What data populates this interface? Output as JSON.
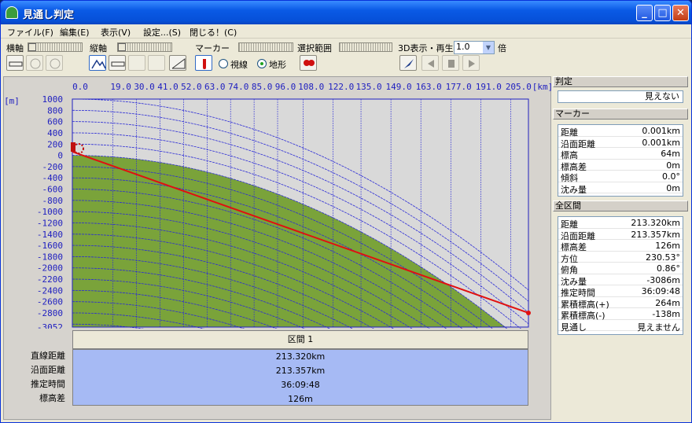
{
  "window": {
    "title": "見通し判定",
    "minimize": "_",
    "maximize": "□",
    "close": "✕"
  },
  "menu": [
    "ファイル(F)",
    "編集(E)",
    "表示(V)",
    "設定...(S)",
    "閉じる！(C)"
  ],
  "toolbar": {
    "horizontal_axis": "横軸",
    "vertical_axis": "縦軸",
    "marker": "マーカー",
    "selection_range": "選択範囲",
    "playback_3d": "3D表示・再生",
    "speed_value": "1.0",
    "speed_unit": "倍",
    "sight_line": "視線",
    "terrain": "地形",
    "radio_selected": "terrain"
  },
  "chart_data": {
    "type": "line",
    "x_ticks": [
      "0.0",
      "19.0",
      "30.0",
      "41.0",
      "52.0",
      "63.0",
      "74.0",
      "85.0",
      "96.0",
      "108.0",
      "122.0",
      "135.0",
      "149.0",
      "163.0",
      "177.0",
      "191.0",
      "205.0"
    ],
    "x_unit": "[km]",
    "y_ticks": [
      "1000",
      "800",
      "600",
      "400",
      "200",
      "0",
      "-200",
      "-400",
      "-600",
      "-800",
      "-1000",
      "-1200",
      "-1400",
      "-1600",
      "-1800",
      "-2000",
      "-2200",
      "-2400",
      "-2600",
      "-2800",
      "-3052"
    ],
    "y_unit": "[m]",
    "xlim": [
      0,
      213.32
    ],
    "ylim": [
      -3052,
      1000
    ],
    "sight_line": {
      "start": [
        0,
        64
      ],
      "end": [
        213.32,
        -2800
      ]
    },
    "colors": {
      "terrain": "#7aa33a",
      "sky": "#d9d9d9",
      "grid": "#2b2bd6",
      "sight": "#e01010"
    }
  },
  "section": {
    "label": "区間 1",
    "rows": [
      {
        "label": "直線距離",
        "value": "213.320km"
      },
      {
        "label": "沿面距離",
        "value": "213.357km"
      },
      {
        "label": "推定時間",
        "value": "36:09:48"
      },
      {
        "label": "標高差",
        "value": "126m"
      }
    ]
  },
  "side": {
    "judgement_title": "判定",
    "judgement_value": "見えない",
    "marker_title": "マーカー",
    "marker_rows": [
      {
        "k": "距離",
        "v": "0.001km"
      },
      {
        "k": "沿面距離",
        "v": "0.001km"
      },
      {
        "k": "標高",
        "v": "64m"
      },
      {
        "k": "標高差",
        "v": "0m"
      },
      {
        "k": "傾斜",
        "v": "0.0°"
      },
      {
        "k": "沈み量",
        "v": "0m"
      }
    ],
    "total_title": "全区間",
    "total_rows": [
      {
        "k": "距離",
        "v": "213.320km"
      },
      {
        "k": "沿面距離",
        "v": "213.357km"
      },
      {
        "k": "標高差",
        "v": "126m"
      },
      {
        "k": "方位",
        "v": "230.53°"
      },
      {
        "k": "俯角",
        "v": "0.86°"
      },
      {
        "k": "沈み量",
        "v": "-3086m"
      },
      {
        "k": "推定時間",
        "v": "36:09:48"
      },
      {
        "k": "累積標高(+)",
        "v": "264m"
      },
      {
        "k": "累積標高(-)",
        "v": "-138m"
      },
      {
        "k": "見通し",
        "v": "見えません"
      }
    ]
  }
}
